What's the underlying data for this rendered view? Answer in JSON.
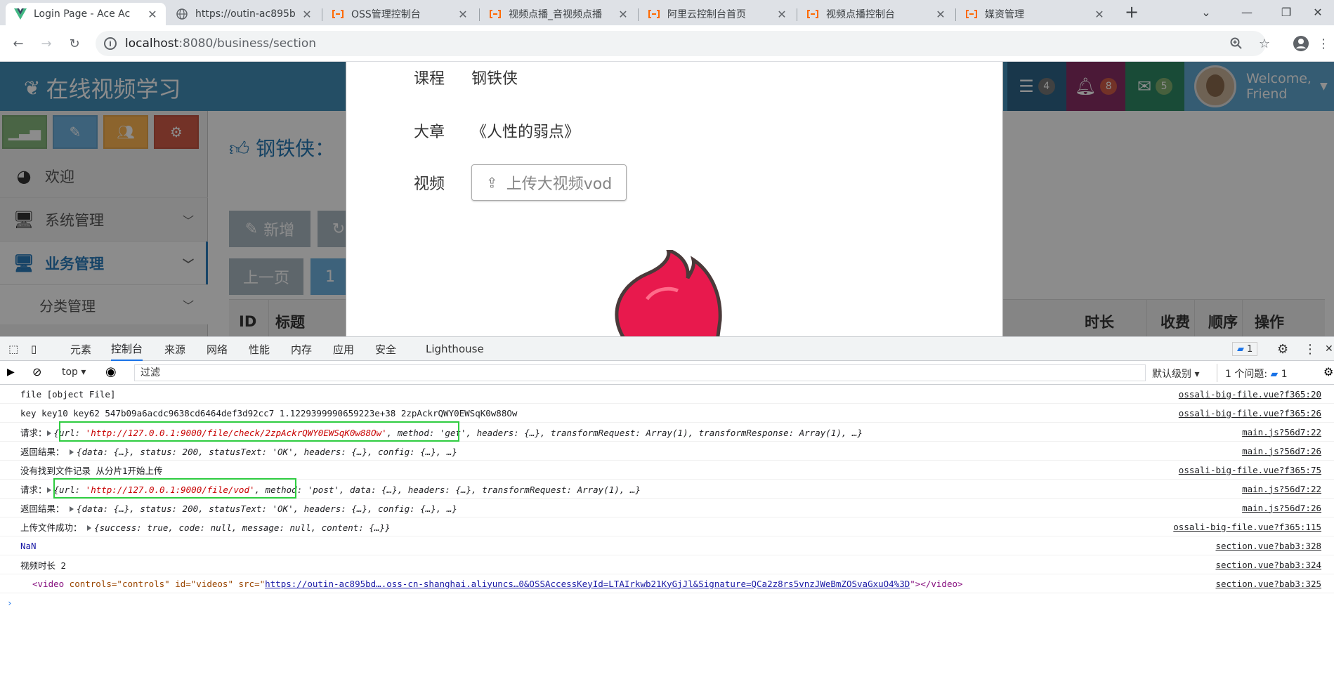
{
  "browser": {
    "tabs": [
      {
        "title": "Login Page - Ace Ac",
        "favicon": "vue-icon",
        "active": true
      },
      {
        "title": "https://outin-ac895b",
        "favicon": "globe-icon",
        "active": false
      },
      {
        "title": "OSS管理控制台",
        "favicon": "aliyun-icon",
        "active": false
      },
      {
        "title": "视频点播_音视频点播",
        "favicon": "aliyun-icon",
        "active": false
      },
      {
        "title": "阿里云控制台首页",
        "favicon": "aliyun-icon",
        "active": false
      },
      {
        "title": "视频点播控制台",
        "favicon": "aliyun-icon",
        "active": false
      },
      {
        "title": "媒资管理",
        "favicon": "aliyun-icon",
        "active": false
      }
    ],
    "url_host": "localhost",
    "url_path": ":8080/business/section"
  },
  "app": {
    "brand": "在线视频学习",
    "badges": {
      "tasks": "4",
      "notifications": "8",
      "messages": "5"
    },
    "welcome_line1": "Welcome,",
    "welcome_line2": "Friend",
    "menu": {
      "welcome": "欢迎",
      "system": "系统管理",
      "business": "业务管理",
      "category": "分类管理"
    },
    "page_title": "钢铁侠：",
    "buttons": {
      "add": "新增",
      "prev": "上一页",
      "page": "1"
    },
    "table_headers_left": [
      "ID",
      "标题"
    ],
    "table_headers_right": [
      "时长",
      "收费",
      "顺序",
      "操作"
    ]
  },
  "modal": {
    "course_label": "课程",
    "course_value": "钢铁侠",
    "chapter_label": "大章",
    "chapter_value": "《人性的弱点》",
    "video_label": "视频",
    "upload_button": "上传大视频vod"
  },
  "devtools": {
    "tabs": [
      "元素",
      "控制台",
      "来源",
      "网络",
      "性能",
      "内存",
      "应用",
      "安全",
      "Lighthouse"
    ],
    "active_tab": "控制台",
    "issues_count": "1",
    "context": "top",
    "filter_placeholder": "过滤",
    "level": "默认级别",
    "issues_label": "1 个问题:",
    "issues_badge": "1",
    "logs": [
      {
        "text": "file  [object File]",
        "src": "ossali-big-file.vue?f365:20"
      },
      {
        "text": "key key10 key62   547b09a6acdc9638cd6464def3d92cc7 1.1229399990659223e+38 2zpAckrQWY0EWSqK0w88Ow",
        "src": "ossali-big-file.vue?f365:26"
      },
      {
        "label": "请求：",
        "obj_url": "'http://127.0.0.1:9000/file/check/2zpAckrQWY0EWSqK0w88Ow'",
        "obj_rest": ", method: 'get', headers: {…}, transformRequest: Array(1), transformResponse: Array(1), …}",
        "src": "main.js?56d7:22"
      },
      {
        "label": "返回结果：",
        "obj": "{data: {…}, status: 200, statusText: 'OK', headers: {…}, config: {…}, …}",
        "src": "main.js?56d7:26"
      },
      {
        "text": "没有找到文件记录 从分片1开始上传",
        "src": "ossali-big-file.vue?f365:75"
      },
      {
        "label": "请求：",
        "obj_url": "'http://127.0.0.1:9000/file/vod'",
        "obj_rest": ", method: 'post', data: {…}, headers: {…}, transformRequest: Array(1), …}",
        "src": "main.js?56d7:22"
      },
      {
        "label": "返回结果：",
        "obj": "{data: {…}, status: 200, statusText: 'OK', headers: {…}, config: {…}, …}",
        "src": "main.js?56d7:26"
      },
      {
        "label": "上传文件成功：",
        "obj": "{success: true, code: null, message: null, content: {…}}",
        "src": "ossali-big-file.vue?f365:115"
      },
      {
        "text": "NaN",
        "src": "section.vue?bab3:328"
      },
      {
        "text": "视频时长  2",
        "src": "section.vue?bab3:324"
      },
      {
        "html_tag_open": "<video",
        "attrs": " controls=\"controls\" id=\"videos\" src=\"",
        "link": "https://outin-ac895bd….oss-cn-shanghai.aliyuncs…0&OSSAccessKeyId=LTAIrkwb21KyGjJl&Signature=QCa2z8rs5vnzJWeBmZOSvaGxuO4%3D",
        "tag_close": "\"></video>",
        "src": "section.vue?bab3:325"
      }
    ]
  },
  "colors": {
    "nav_blue": "#438eb9",
    "badge_dark": "#2e6589",
    "badge_purple": "#892e65",
    "badge_green": "#2e8965",
    "shortcut_green": "#87b87f",
    "shortcut_blue": "#6fb3e0",
    "shortcut_yellow": "#ffb752",
    "shortcut_red": "#d15b47",
    "highlight_green": "#2ecc40"
  }
}
